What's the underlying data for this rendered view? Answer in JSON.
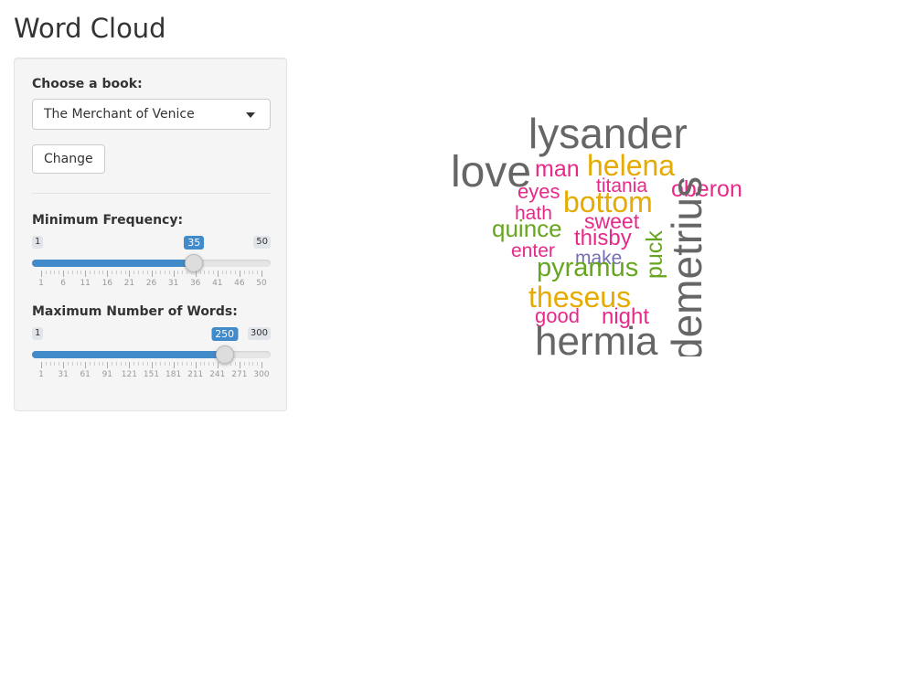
{
  "page": {
    "title": "Word Cloud"
  },
  "book_select": {
    "label": "Choose a book:",
    "value": "The Merchant of Venice"
  },
  "change_button": {
    "label": "Change"
  },
  "min_freq": {
    "label": "Minimum Frequency:",
    "min_label": "1",
    "max_label": "50",
    "value_label": "35",
    "min": 1,
    "max": 50,
    "value": 35,
    "ticks": [
      "1",
      "6",
      "11",
      "16",
      "21",
      "26",
      "31",
      "36",
      "41",
      "46",
      "50"
    ]
  },
  "max_words": {
    "label": "Maximum Number of Words:",
    "min_label": "1",
    "max_label": "300",
    "value_label": "250",
    "min": 1,
    "max": 300,
    "value": 250,
    "ticks": [
      "1",
      "31",
      "61",
      "91",
      "121",
      "151",
      "181",
      "211",
      "241",
      "271",
      "300"
    ]
  },
  "colors": {
    "accent": "#428bca",
    "gray": "#666666",
    "pink": "#e7298a",
    "orange": "#e6ab02",
    "green": "#66a61e",
    "purple": "#7570b3"
  },
  "cloud": {
    "words": [
      {
        "text": "lysander",
        "color": "#666666"
      },
      {
        "text": "love",
        "color": "#666666"
      },
      {
        "text": "man",
        "color": "#e7298a"
      },
      {
        "text": "helena",
        "color": "#e6ab02"
      },
      {
        "text": "titania",
        "color": "#e7298a"
      },
      {
        "text": "eyes",
        "color": "#e7298a"
      },
      {
        "text": "oberon",
        "color": "#e7298a"
      },
      {
        "text": "bottom",
        "color": "#e6ab02"
      },
      {
        "text": "hath",
        "color": "#e7298a"
      },
      {
        "text": "sweet",
        "color": "#e7298a"
      },
      {
        "text": "quince",
        "color": "#66a61e"
      },
      {
        "text": "thisby",
        "color": "#e7298a"
      },
      {
        "text": "enter",
        "color": "#e7298a"
      },
      {
        "text": "make",
        "color": "#7570b3"
      },
      {
        "text": "puck",
        "color": "#66a61e"
      },
      {
        "text": "demetrius",
        "color": "#666666"
      },
      {
        "text": "pyramus",
        "color": "#66a61e"
      },
      {
        "text": "theseus",
        "color": "#e6ab02"
      },
      {
        "text": "good",
        "color": "#e7298a"
      },
      {
        "text": "night",
        "color": "#e7298a"
      },
      {
        "text": "hermia",
        "color": "#666666"
      }
    ]
  }
}
